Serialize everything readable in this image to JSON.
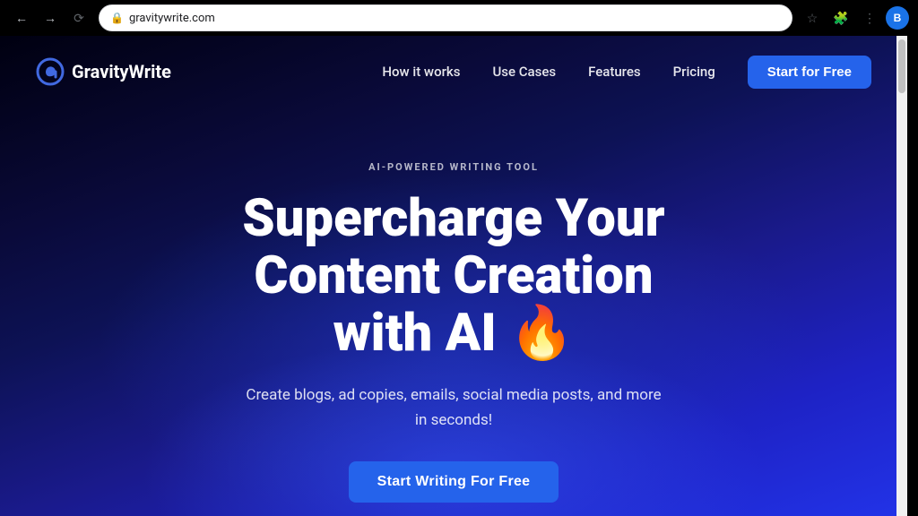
{
  "browser": {
    "back_disabled": true,
    "forward_disabled": true,
    "url": "gravitywrite.com",
    "profile_initial": "B",
    "profile_color": "#1a73e8"
  },
  "navbar": {
    "logo_text": "GravityWrite",
    "links": [
      {
        "label": "How it works",
        "id": "how-it-works"
      },
      {
        "label": "Use Cases",
        "id": "use-cases"
      },
      {
        "label": "Features",
        "id": "features"
      },
      {
        "label": "Pricing",
        "id": "pricing"
      }
    ],
    "cta_label": "Start for Free"
  },
  "hero": {
    "badge": "AI-POWERED WRITING TOOL",
    "title_line1": "Supercharge Your",
    "title_line2": "Content Creation",
    "title_line3": "with AI 🔥",
    "subtitle": "Create blogs, ad copies, emails, social media posts, and more in seconds!",
    "cta_label": "Start Writing For Free"
  }
}
